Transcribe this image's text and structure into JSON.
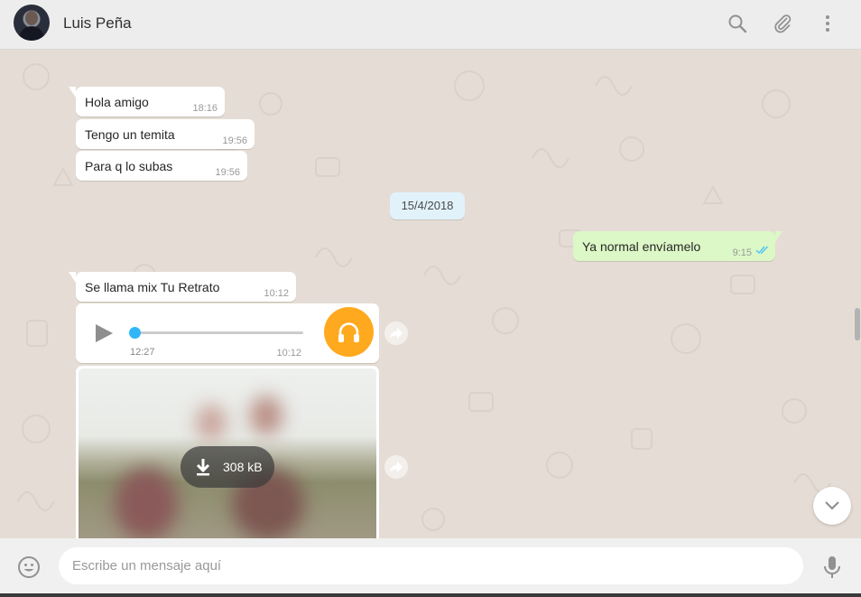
{
  "header": {
    "contact_name": "Luis Peña",
    "icons": [
      "search-icon",
      "attach-icon",
      "menu-icon"
    ]
  },
  "colors": {
    "chat_bg": "#e5ddd5",
    "header_bg": "#ededed",
    "incoming_bubble": "#ffffff",
    "outgoing_bubble": "#dcf8c6",
    "date_chip": "#e1f2fb",
    "audio_accent": "#ffa91e",
    "progress_knob": "#30b6f6",
    "read_ticks": "#4fc3f7"
  },
  "messages": [
    {
      "text": "Hola amigo",
      "time": "18:16"
    },
    {
      "text": "Tengo un temita",
      "time": "19:56"
    },
    {
      "text": "Para q lo subas",
      "time": "19:56"
    },
    {
      "text": "Ya normal envíamelo",
      "time": "9:15"
    },
    {
      "text": "Se llama mix Tu Retrato",
      "time": "10:12"
    }
  ],
  "date_divider": "15/4/2018",
  "audio_message": {
    "elapsed": "12:27",
    "time": "10:12",
    "progress": 0
  },
  "image_message": {
    "download_size": "308 kB"
  },
  "composer": {
    "placeholder": "Escribe un mensaje aquí"
  }
}
